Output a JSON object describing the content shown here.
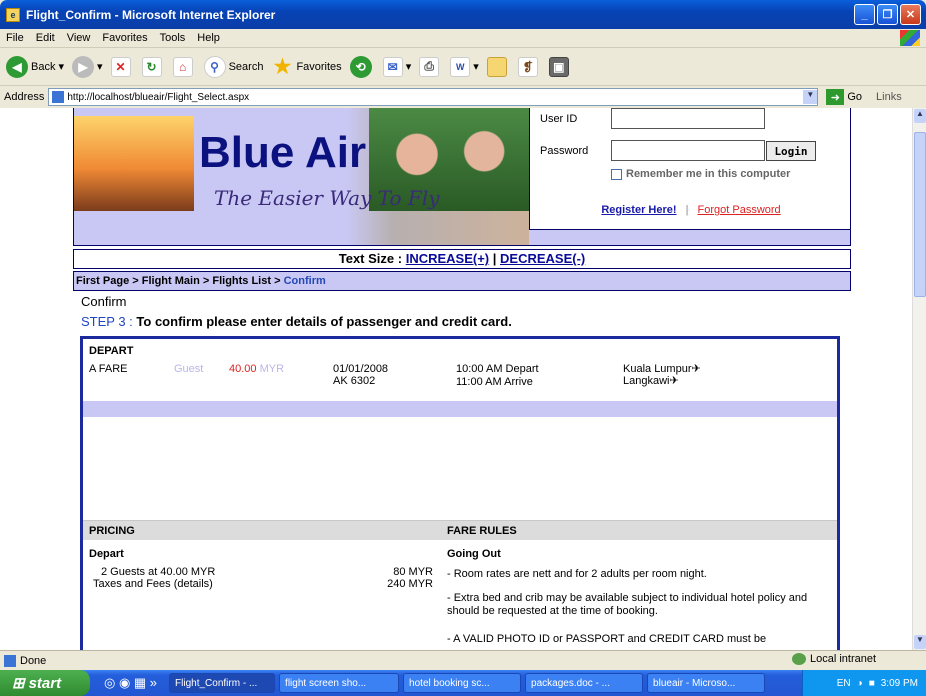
{
  "window": {
    "title": "Flight_Confirm - Microsoft Internet Explorer"
  },
  "menu": [
    "File",
    "Edit",
    "View",
    "Favorites",
    "Tools",
    "Help"
  ],
  "toolbar": {
    "back": "Back",
    "search": "Search",
    "favorites": "Favorites"
  },
  "address": {
    "label": "Address",
    "url": "http://localhost/blueair/Flight_Select.aspx",
    "go": "Go",
    "links": "Links"
  },
  "banner": {
    "logo": "Blue Air",
    "tagline": "The Easier Way To Fly"
  },
  "login": {
    "userid_label": "User ID",
    "password_label": "Password",
    "login_button": "Login",
    "remember": "Remember me in this computer",
    "register": "Register Here!",
    "separator": "|",
    "forgot": "Forgot Password"
  },
  "textsize": {
    "label": "Text Size  :",
    "increase": "INCREASE(+)",
    "sep": "|",
    "decrease": "DECREASE(-)"
  },
  "breadcrumb": {
    "items": [
      "First Page",
      "Flight Main",
      "Flights List"
    ],
    "sep": ">",
    "current": "Confirm"
  },
  "page": {
    "heading": "Confirm",
    "step_num": "STEP 3 :",
    "step_text": "To confirm please enter details of passenger and credit card."
  },
  "flight": {
    "depart_label": "DEPART",
    "fare_class": "A FARE",
    "guest": "Guest",
    "price": "40.00",
    "currency": "MYR",
    "date": "01/01/2008",
    "flight_no": "AK 6302",
    "depart_time": "10:00 AM Depart",
    "arrive_time": "11:00 AM Arrive",
    "from": "Kuala Lumpur",
    "to": "Langkawi"
  },
  "pricing": {
    "header": "PRICING",
    "depart": "Depart",
    "guests_line": "2 Guests at 40.00 MYR",
    "guests_amount": "80 MYR",
    "taxes_line": "Taxes and Fees (details)",
    "taxes_amount": "240 MYR"
  },
  "fare_rules": {
    "header": "FARE RULES",
    "going_out": "Going Out",
    "rule1": "- Room rates are nett and for 2 adults per room night.",
    "rule2": "- Extra bed and crib may be available subject to individual hotel policy and should be requested at the time of booking.",
    "rule3": "- A VALID PHOTO ID or PASSPORT and CREDIT CARD must be"
  },
  "status": {
    "text": "Done",
    "zone": "Local intranet"
  },
  "taskbar": {
    "start": "start",
    "tasks": [
      "Flight_Confirm - ...",
      "flight screen sho...",
      "hotel booking sc...",
      "packages.doc - ...",
      "blueair - Microso..."
    ],
    "lang": "EN",
    "clock": "3:09 PM"
  }
}
